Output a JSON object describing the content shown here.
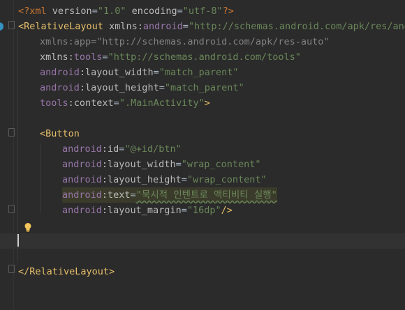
{
  "editor": {
    "lines": [
      {
        "tokens": [
          {
            "t": "<?",
            "c": "pi"
          },
          {
            "t": "xml ",
            "c": "pi"
          },
          {
            "t": "version",
            "c": "attr"
          },
          {
            "t": "=",
            "c": "plain"
          },
          {
            "t": "\"1.0\"",
            "c": "str"
          },
          {
            "t": " encoding",
            "c": "attr"
          },
          {
            "t": "=",
            "c": "plain"
          },
          {
            "t": "\"utf-8\"",
            "c": "str"
          },
          {
            "t": "?>",
            "c": "pi"
          }
        ]
      },
      {
        "tokens": [
          {
            "t": "<",
            "c": "tag"
          },
          {
            "t": "RelativeLayout ",
            "c": "tag"
          },
          {
            "t": "xmlns:",
            "c": "attr"
          },
          {
            "t": "android",
            "c": "ns"
          },
          {
            "t": "=",
            "c": "plain"
          },
          {
            "t": "\"http://schemas.android.com/apk/res/andr",
            "c": "str"
          }
        ]
      },
      {
        "tokens": [
          {
            "t": "xmlns:app=",
            "c": "dim"
          },
          {
            "t": "\"http://schemas.android.com/apk/res-auto\"",
            "c": "dim"
          }
        ]
      },
      {
        "tokens": [
          {
            "t": "xmlns:",
            "c": "attr"
          },
          {
            "t": "tools",
            "c": "ns"
          },
          {
            "t": "=",
            "c": "plain"
          },
          {
            "t": "\"http://schemas.android.com/tools\"",
            "c": "str"
          }
        ]
      },
      {
        "tokens": [
          {
            "t": "android",
            "c": "ns"
          },
          {
            "t": ":layout_width",
            "c": "attr"
          },
          {
            "t": "=",
            "c": "plain"
          },
          {
            "t": "\"match_parent\"",
            "c": "str"
          }
        ]
      },
      {
        "tokens": [
          {
            "t": "android",
            "c": "ns"
          },
          {
            "t": ":layout_height",
            "c": "attr"
          },
          {
            "t": "=",
            "c": "plain"
          },
          {
            "t": "\"match_parent\"",
            "c": "str"
          }
        ]
      },
      {
        "tokens": [
          {
            "t": "tools",
            "c": "ns"
          },
          {
            "t": ":context",
            "c": "attr"
          },
          {
            "t": "=",
            "c": "plain"
          },
          {
            "t": "\".MainActivity\"",
            "c": "str"
          },
          {
            "t": ">",
            "c": "tag"
          }
        ]
      },
      {
        "tokens": []
      },
      {
        "tokens": [
          {
            "t": "<Button",
            "c": "tag"
          }
        ]
      },
      {
        "tokens": [
          {
            "t": "android",
            "c": "ns"
          },
          {
            "t": ":id",
            "c": "attr"
          },
          {
            "t": "=",
            "c": "plain"
          },
          {
            "t": "\"@+id/btn\"",
            "c": "str"
          }
        ]
      },
      {
        "tokens": [
          {
            "t": "android",
            "c": "ns"
          },
          {
            "t": ":layout_width",
            "c": "attr"
          },
          {
            "t": "=",
            "c": "plain"
          },
          {
            "t": "\"wrap_content\"",
            "c": "str"
          }
        ]
      },
      {
        "tokens": [
          {
            "t": "android",
            "c": "ns"
          },
          {
            "t": ":layout_height",
            "c": "attr"
          },
          {
            "t": "=",
            "c": "plain"
          },
          {
            "t": "\"wrap_content\"",
            "c": "str"
          }
        ]
      },
      {
        "tokens": [
          {
            "t": "android",
            "c": "ns"
          },
          {
            "t": ":text",
            "c": "attr"
          },
          {
            "t": "=",
            "c": "plain"
          },
          {
            "t": "\"묵시적 인텐트로 액티비티 실행\"",
            "c": "str"
          }
        ]
      },
      {
        "tokens": [
          {
            "t": "android",
            "c": "ns"
          },
          {
            "t": ":layout_margin",
            "c": "attr"
          },
          {
            "t": "=",
            "c": "plain"
          },
          {
            "t": "\"16dp\"",
            "c": "str"
          },
          {
            "t": "/>",
            "c": "tag"
          }
        ]
      },
      {
        "tokens": []
      },
      {
        "tokens": []
      },
      {
        "tokens": []
      },
      {
        "tokens": [
          {
            "t": "</RelativeLayout>",
            "c": "tag"
          }
        ]
      }
    ]
  }
}
